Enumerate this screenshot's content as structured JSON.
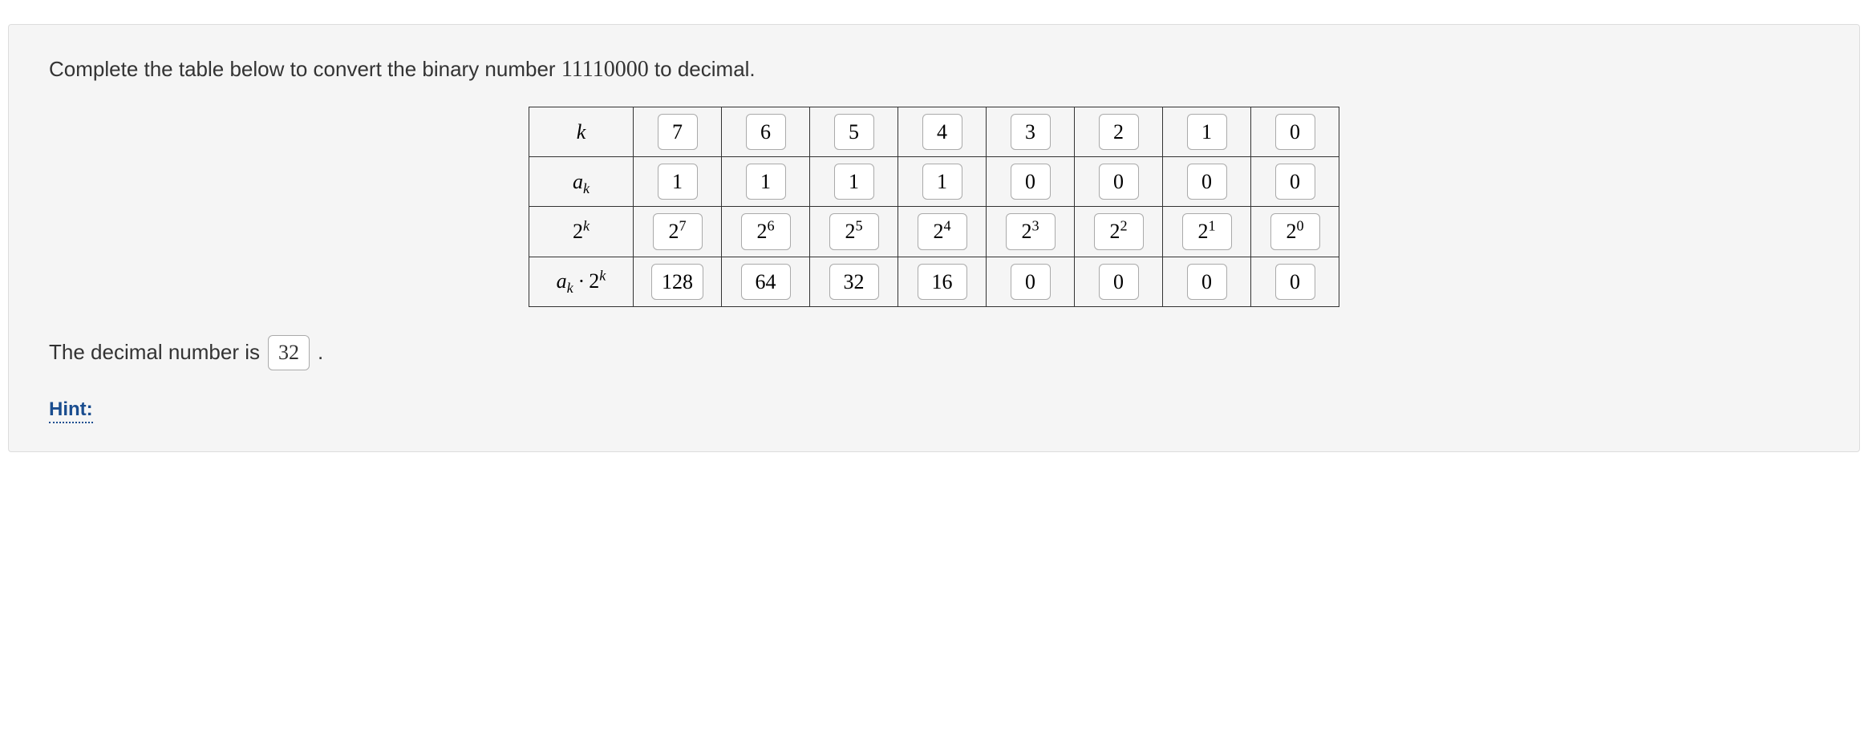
{
  "prompt": {
    "before": "Complete the table below to convert the binary number ",
    "number": "11110000",
    "after": " to decimal."
  },
  "table": {
    "rows": [
      {
        "label_html": "k",
        "cells": [
          "7",
          "6",
          "5",
          "4",
          "3",
          "2",
          "1",
          "0"
        ],
        "power": false
      },
      {
        "label_html": "<i>a<sub>k</sub></i>",
        "cells": [
          "1",
          "1",
          "1",
          "1",
          "0",
          "0",
          "0",
          "0"
        ],
        "power": false
      },
      {
        "label_html": "<span class=\"upright\">2</span><sup><i>k</i></sup>",
        "cells": [
          "7",
          "6",
          "5",
          "4",
          "3",
          "2",
          "1",
          "0"
        ],
        "power": true
      },
      {
        "label_html": "<i>a<sub>k</sub></i> · <span class=\"upright\">2</span><sup><i>k</i></sup>",
        "cells": [
          "128",
          "64",
          "32",
          "16",
          "0",
          "0",
          "0",
          "0"
        ],
        "power": false
      }
    ]
  },
  "answer": {
    "before": "The decimal number is",
    "value": "32",
    "after": "."
  },
  "hint_label": "Hint:"
}
